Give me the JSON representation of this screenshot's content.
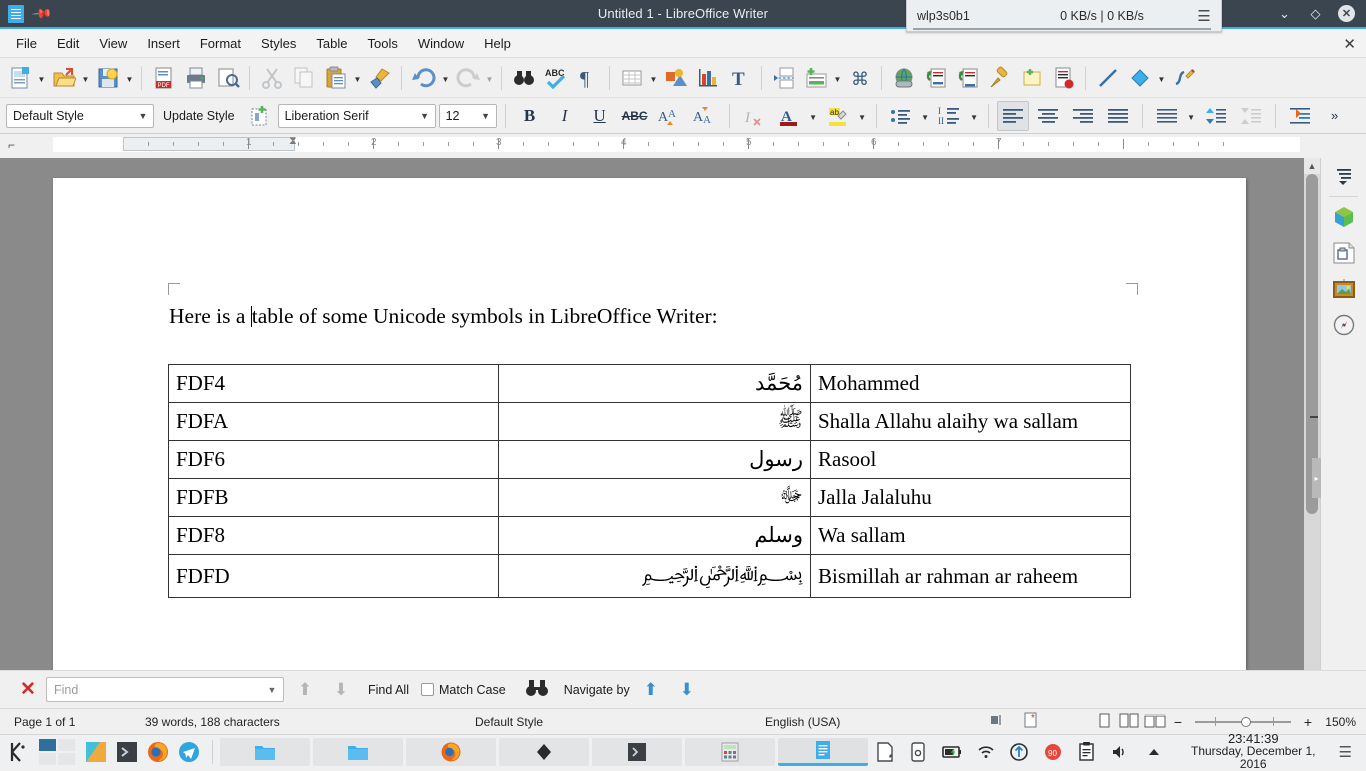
{
  "titlebar": {
    "title": "Untitled 1 - LibreOffice Writer",
    "doc_icon": "document-icon",
    "pin_icon": "pin-icon",
    "minimize_label": "⌄",
    "maximize_label": "◇",
    "close_label": "✕"
  },
  "netmon": {
    "interface": "wlp3s0b1",
    "rate": "0 KB/s | 0 KB/s",
    "menu_icon": "hamburger-icon"
  },
  "menubar": {
    "items": [
      "File",
      "Edit",
      "View",
      "Insert",
      "Format",
      "Styles",
      "Table",
      "Tools",
      "Window",
      "Help"
    ],
    "close_doc_label": "✕"
  },
  "toolbar": {
    "items": [
      {
        "name": "new-document",
        "label": "New"
      },
      {
        "name": "open-file",
        "label": "Open"
      },
      {
        "name": "save-document",
        "label": "Save"
      },
      {
        "name": "export-pdf",
        "label": "Export as PDF"
      },
      {
        "name": "print-document",
        "label": "Print"
      },
      {
        "name": "print-preview",
        "label": "Print Preview"
      },
      {
        "name": "cut",
        "label": "Cut"
      },
      {
        "name": "copy",
        "label": "Copy"
      },
      {
        "name": "paste",
        "label": "Paste"
      },
      {
        "name": "clone-formatting",
        "label": "Clone Formatting"
      },
      {
        "name": "undo",
        "label": "Undo"
      },
      {
        "name": "redo",
        "label": "Redo"
      },
      {
        "name": "find-and-replace",
        "label": "Find and Replace"
      },
      {
        "name": "spelling",
        "label": "Spelling"
      },
      {
        "name": "formatting-marks",
        "label": "Formatting Marks"
      },
      {
        "name": "insert-table",
        "label": "Insert Table"
      },
      {
        "name": "insert-image",
        "label": "Insert Image"
      },
      {
        "name": "insert-chart",
        "label": "Insert Chart"
      },
      {
        "name": "insert-text-box",
        "label": "Insert Text Box"
      },
      {
        "name": "insert-page-break",
        "label": "Insert Page Break"
      },
      {
        "name": "insert-field",
        "label": "Insert Field"
      },
      {
        "name": "insert-special-character",
        "label": "Insert Special Character"
      },
      {
        "name": "insert-hyperlink",
        "label": "Insert Hyperlink"
      },
      {
        "name": "insert-footnote",
        "label": "Insert Footnote"
      },
      {
        "name": "insert-endnote",
        "label": "Insert Endnote"
      },
      {
        "name": "insert-bookmark",
        "label": "Insert Bookmark"
      },
      {
        "name": "insert-comment",
        "label": "Insert Comment"
      },
      {
        "name": "track-changes",
        "label": "Track Changes"
      },
      {
        "name": "insert-line",
        "label": "Insert Line"
      },
      {
        "name": "basic-shapes",
        "label": "Basic Shapes"
      },
      {
        "name": "show-draw-functions",
        "label": "Show Draw Functions"
      }
    ]
  },
  "formatbar": {
    "paragraph_style": "Default Style",
    "update_style_label": "Update Style",
    "new_style_icon": "new-style-icon",
    "font_name": "Liberation Serif",
    "font_size": "12",
    "bold": "B",
    "italic": "I",
    "underline": "U",
    "strikethrough": "ABC",
    "superscript": "A²",
    "subscript": "A₂",
    "clear_formatting": "clear-formatting-icon",
    "font_color": "font-color-icon",
    "highlight_color": "highlight-color-icon",
    "unordered_list": "bullet-list-icon",
    "ordered_list": "numbered-list-icon",
    "align_left": "align-left-icon",
    "align_center": "align-center-icon",
    "align_right": "align-right-icon",
    "align_justified": "align-justified-icon",
    "line_spacing": "line-spacing-icon",
    "increase_spacing": "increase-paragraph-spacing-icon",
    "decrease_spacing": "decrease-paragraph-spacing-icon",
    "increase_indent": "increase-indent-icon",
    "overflow": "»"
  },
  "ruler": {
    "numbers": [
      "1",
      "2",
      "3",
      "4",
      "5",
      "6",
      "7"
    ],
    "corner_icon": "tab-stop-icon"
  },
  "document": {
    "paragraph_before_cursor": "Here is a ",
    "paragraph_after_cursor": "table of some Unicode symbols in LibreOffice Writer:",
    "table": {
      "rows": [
        {
          "code": "FDF4",
          "glyph": "مُحَمَّد",
          "meaning": "Mohammed"
        },
        {
          "code": "FDFA",
          "glyph": "ﷺ",
          "meaning": "Shalla Allahu alaihy wa sallam"
        },
        {
          "code": "FDF6",
          "glyph": "رسول",
          "meaning": "Rasool"
        },
        {
          "code": "FDFB",
          "glyph": "ﷻ",
          "meaning": "Jalla Jalaluhu"
        },
        {
          "code": "FDF8",
          "glyph": "وسلم",
          "meaning": "Wa sallam"
        },
        {
          "code": "FDFD",
          "glyph": "﷽",
          "meaning": "Bismillah ar rahman ar raheem"
        }
      ]
    }
  },
  "sidebar": {
    "items": [
      {
        "name": "sidebar-settings",
        "icon": "sidebar-settings-icon"
      },
      {
        "name": "sidebar-properties",
        "icon": "properties-cube-icon"
      },
      {
        "name": "sidebar-page",
        "icon": "page-icon"
      },
      {
        "name": "sidebar-gallery",
        "icon": "gallery-picture-icon"
      },
      {
        "name": "sidebar-navigator",
        "icon": "compass-navigator-icon"
      }
    ],
    "hide_handle": "▸"
  },
  "findbar": {
    "close_label": "✕",
    "placeholder": "Find",
    "value": "",
    "find_previous_icon": "arrow-up-icon",
    "find_next_icon": "arrow-down-icon",
    "find_all_label": "Find All",
    "match_case_label": "Match Case",
    "match_case_checked": false,
    "find_replace_icon": "binoculars-icon",
    "navigate_by_label": "Navigate by",
    "nav_previous_icon": "arrow-up-icon",
    "nav_next_icon": "arrow-down-icon"
  },
  "statusbar": {
    "page": "Page 1 of 1",
    "word_count": "39 words, 188 characters",
    "page_style": "Default Style",
    "language": "English (USA)",
    "selection_mode_icon": "selection-mode-icon",
    "modified_icon": "document-modified-icon",
    "view_single_icon": "single-page-view-icon",
    "view_multi_icon": "multi-page-view-icon",
    "view_book_icon": "book-view-icon",
    "zoom_out": "−",
    "zoom_in": "+",
    "zoom_level": "150%"
  },
  "taskbar": {
    "launcher_icon": "kde-menu-icon",
    "pager_icon": "desktop-pager",
    "pinned": [
      {
        "name": "kde-app-icon"
      },
      {
        "name": "terminal-icon"
      },
      {
        "name": "firefox-icon"
      },
      {
        "name": "telegram-icon"
      }
    ],
    "tasks": [
      {
        "name": "task-file-manager-1",
        "icon": "folder-icon"
      },
      {
        "name": "task-file-manager-2",
        "icon": "folder-icon"
      },
      {
        "name": "task-firefox",
        "icon": "firefox-icon"
      },
      {
        "name": "task-dark-app",
        "icon": "diamond-icon"
      },
      {
        "name": "task-terminal",
        "icon": "terminal-icon"
      },
      {
        "name": "task-calculator",
        "icon": "calculator-icon"
      },
      {
        "name": "task-libreoffice-writer",
        "icon": "document-icon"
      }
    ],
    "tray": [
      {
        "name": "tray-note-icon"
      },
      {
        "name": "tray-device-icon"
      },
      {
        "name": "tray-battery-icon"
      },
      {
        "name": "tray-network-icon"
      },
      {
        "name": "tray-updates-icon"
      },
      {
        "name": "tray-dropbox-icon"
      },
      {
        "name": "tray-clipboard-icon"
      },
      {
        "name": "tray-volume-icon"
      },
      {
        "name": "tray-expand-icon"
      }
    ],
    "clock_time": "23:41:39",
    "clock_date": "Thursday, December 1, 2016",
    "tray_menu_icon": "hamburger-icon"
  },
  "colors": {
    "accent": "#3daee9",
    "titlebar_bg": "#3b454f",
    "toolbar_bg": "#f0f0f0",
    "desktop_gray": "#8a8a8a"
  }
}
